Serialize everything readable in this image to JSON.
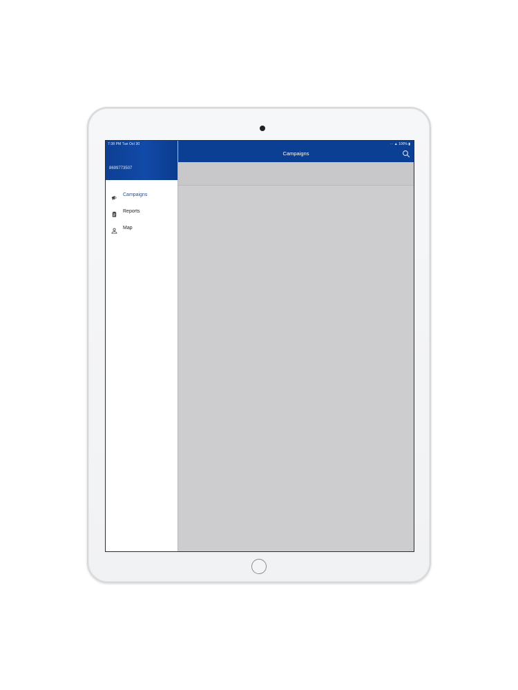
{
  "status_bar": {
    "time_date": "7:38 PM   Tue Oct 30",
    "right": "⋯  ▲ 100% ▮"
  },
  "sidebar": {
    "account_number": "8699773507",
    "items": [
      {
        "label": "Campaigns",
        "icon": "megaphone-icon",
        "active": true
      },
      {
        "label": "Reports",
        "icon": "clipboard-icon",
        "active": false
      },
      {
        "label": "Map",
        "icon": "map-marker-icon",
        "active": false
      }
    ]
  },
  "header": {
    "title": "Campaigns",
    "search_icon": "search-icon"
  },
  "colors": {
    "brand_blue": "#0b3f93",
    "active_text": "#1b4d9e",
    "content_bg": "#cdcdd0"
  }
}
